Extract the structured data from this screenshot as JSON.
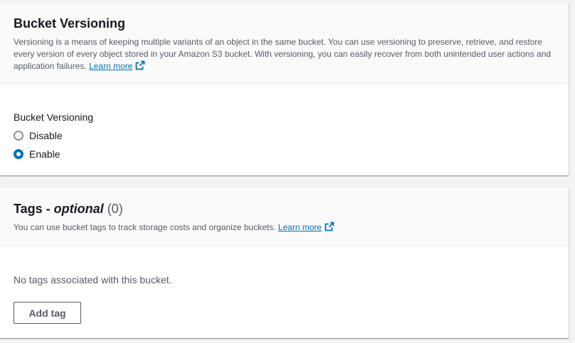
{
  "versioning": {
    "title": "Bucket Versioning",
    "description": "Versioning is a means of keeping multiple variants of an object in the same bucket. You can use versioning to preserve, retrieve, and restore every version of every object stored in your Amazon S3 bucket. With versioning, you can easily recover from both unintended user actions and application failures.",
    "learn_more": "Learn more",
    "field_label": "Bucket Versioning",
    "options": [
      {
        "label": "Disable",
        "selected": false
      },
      {
        "label": "Enable",
        "selected": true
      }
    ]
  },
  "tags": {
    "title_main": "Tags - ",
    "title_optional": "optional",
    "count": "(0)",
    "description": "You can use bucket tags to track storage costs and organize buckets.",
    "learn_more": "Learn more",
    "empty_text": "No tags associated with this bucket.",
    "add_button": "Add tag"
  },
  "colors": {
    "link": "#0073bb",
    "background": "#f2f3f3",
    "radio_selected": "#0073bb"
  },
  "icons": {
    "external_link": "external-link-icon"
  }
}
